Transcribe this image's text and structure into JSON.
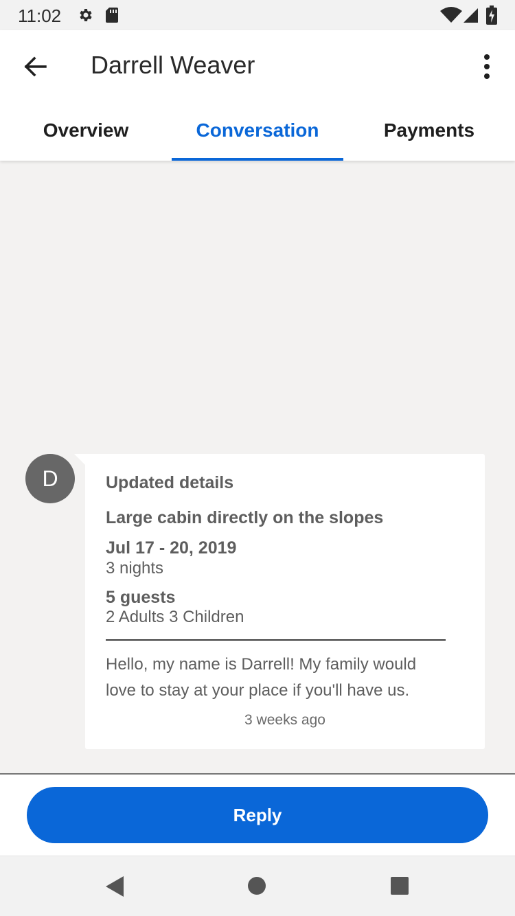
{
  "status_bar": {
    "time": "11:02",
    "icons": [
      "gear-icon",
      "sd-card-icon",
      "wifi-icon",
      "signal-icon",
      "battery-charging-icon"
    ]
  },
  "app_bar": {
    "title": "Darrell Weaver",
    "back_icon": "arrow-left-icon",
    "menu_icon": "more-vertical-icon"
  },
  "tabs": [
    {
      "label": "Overview",
      "selected": false
    },
    {
      "label": "Conversation",
      "selected": true
    },
    {
      "label": "Payments",
      "selected": false
    }
  ],
  "message": {
    "avatar_initial": "D",
    "heading": "Updated details",
    "listing": "Large cabin directly on the slopes",
    "dates": "Jul 17 - 20, 2019",
    "nights": "3 nights",
    "guests": "5 guests",
    "guest_breakdown": "2 Adults 3 Children",
    "body": "Hello, my name is Darrell! My family would love to stay at your place if you'll have us.",
    "timestamp": "3 weeks ago"
  },
  "reply_button": {
    "label": "Reply"
  },
  "nav_bar": {
    "icons": [
      "nav-back-icon",
      "nav-home-icon",
      "nav-recents-icon"
    ]
  },
  "colors": {
    "accent": "#0a67d8",
    "background": "#f3f2f1",
    "avatar": "#676767"
  }
}
